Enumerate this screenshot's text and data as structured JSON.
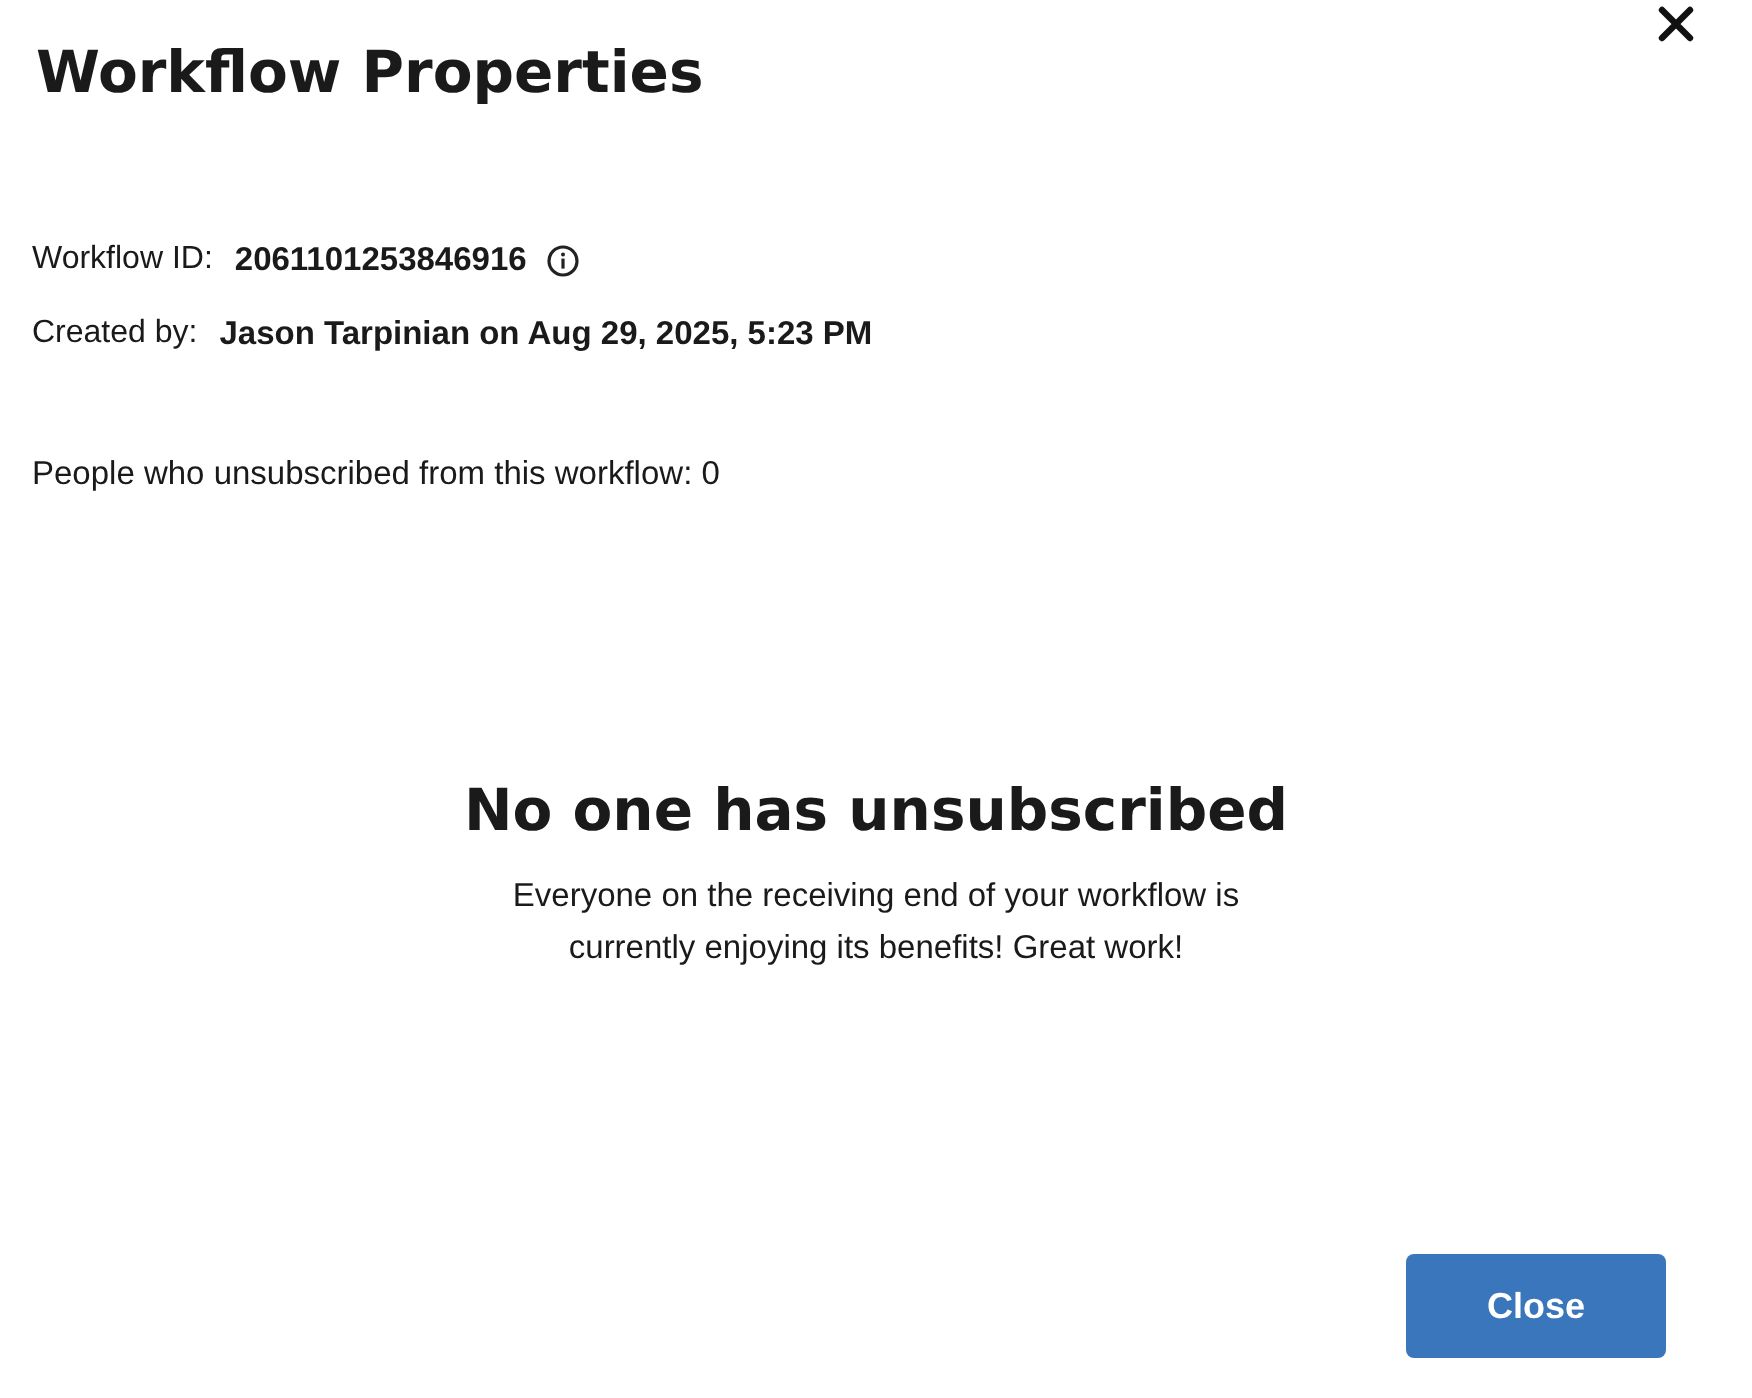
{
  "dialog": {
    "title": "Workflow Properties"
  },
  "details": [
    {
      "label": "Workflow ID:",
      "value": "2061101253846916",
      "info": true
    },
    {
      "label": "Created by:",
      "value": "Jason Tarpinian on Aug 29, 2025, 5:23 PM",
      "info": false
    }
  ],
  "unsubscribed_summary": "People who unsubscribed from this workflow: 0",
  "empty_state": {
    "heading": "No one has unsubscribed",
    "message_lines": [
      "Everyone on the receiving end of your workflow is",
      "currently enjoying its benefits! Great work!"
    ]
  },
  "buttons": [
    {
      "label": "Close",
      "kind": "primary"
    }
  ]
}
